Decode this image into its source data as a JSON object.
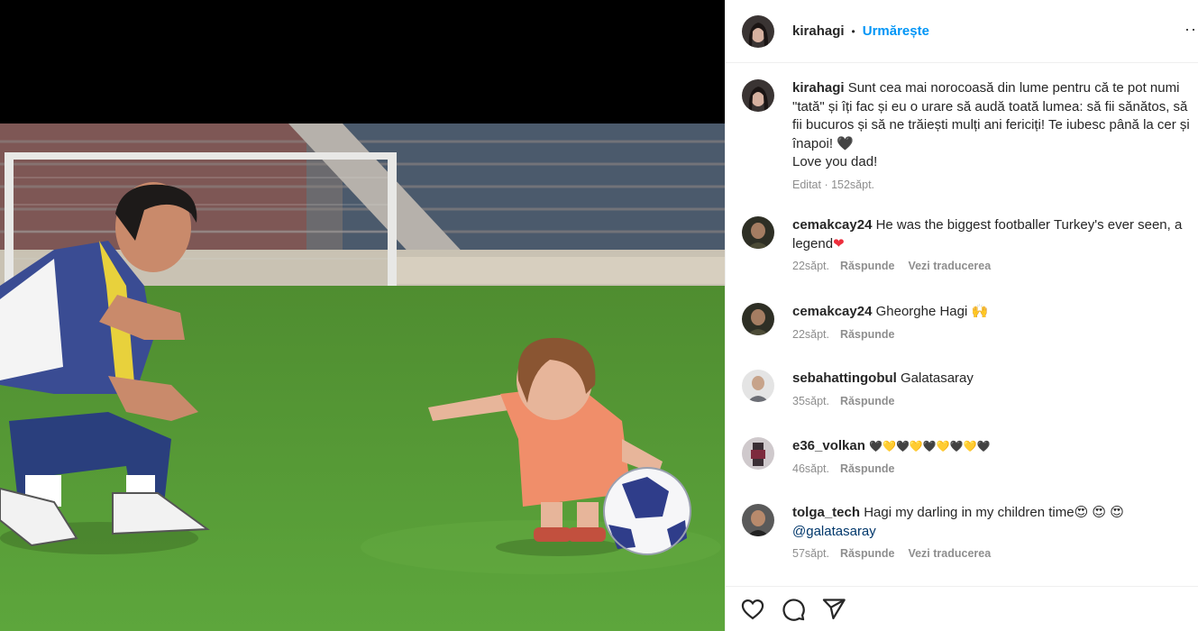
{
  "header": {
    "username": "kirahagi",
    "separator": "•",
    "follow_label": "Urmărește",
    "more_label": "···"
  },
  "caption": {
    "username": "kirahagi",
    "text_line1": "Sunt cea mai norocoasă din lume pentru că te pot numi \"tată\" și îți fac și eu o urare să audă toată lumea: să fii sănătos, să fii bucuros și să ne trăiești mulți ani fericiți! Te iubesc până la cer și înapoi! 🖤",
    "text_line2": "Love you dad!",
    "edited": "Editat",
    "time": "152săpt."
  },
  "comments": [
    {
      "username": "cemakcay24",
      "text": "He was the biggest footballer Turkey's ever seen, a legend",
      "emoji": "❤",
      "time": "22săpt.",
      "reply": "Răspunde",
      "translate": "Vezi traducerea"
    },
    {
      "username": "cemakcay24",
      "text": "Gheorghe Hagi 🙌",
      "time": "22săpt.",
      "reply": "Răspunde"
    },
    {
      "username": "sebahattingobul",
      "text": "Galatasaray",
      "time": "35săpt.",
      "reply": "Răspunde"
    },
    {
      "username": "e36_volkan",
      "text": "🖤💛🖤💛🖤💛🖤💛🖤",
      "time": "46săpt.",
      "reply": "Răspunde"
    },
    {
      "username": "tolga_tech",
      "text": "Hagi my darling in my children time😍 😍 😍",
      "mention": "@galatasaray",
      "time": "57săpt.",
      "reply": "Răspunde",
      "translate": "Vezi traducerea"
    }
  ],
  "actions": {
    "like_icon": "heart-icon",
    "comment_icon": "comment-icon",
    "share_icon": "share-icon"
  },
  "colors": {
    "accent": "#0095f6",
    "text": "#262626",
    "muted": "#8e8e8e",
    "grass": "#5c9a3a"
  }
}
